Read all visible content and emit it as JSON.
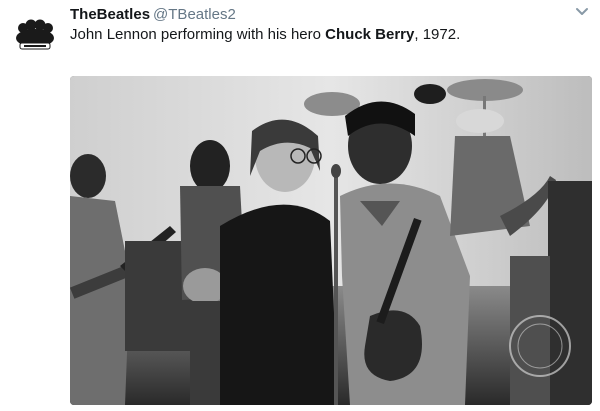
{
  "tweet": {
    "display_name": "TheBeatles",
    "handle": "@TBeatles2",
    "text_before": "John Lennon performing with his hero ",
    "text_bold": "Chuck Berry",
    "text_after": ", 1972.",
    "avatar_icon": "beatles-silhouette-logo",
    "menu_icon": "chevron-down-icon",
    "photo_alt": "John Lennon performing with his hero Chuck Berry, 1972."
  },
  "colors": {
    "name_text": "#14171a",
    "handle_text": "#657786",
    "caret": "#8899a6"
  }
}
